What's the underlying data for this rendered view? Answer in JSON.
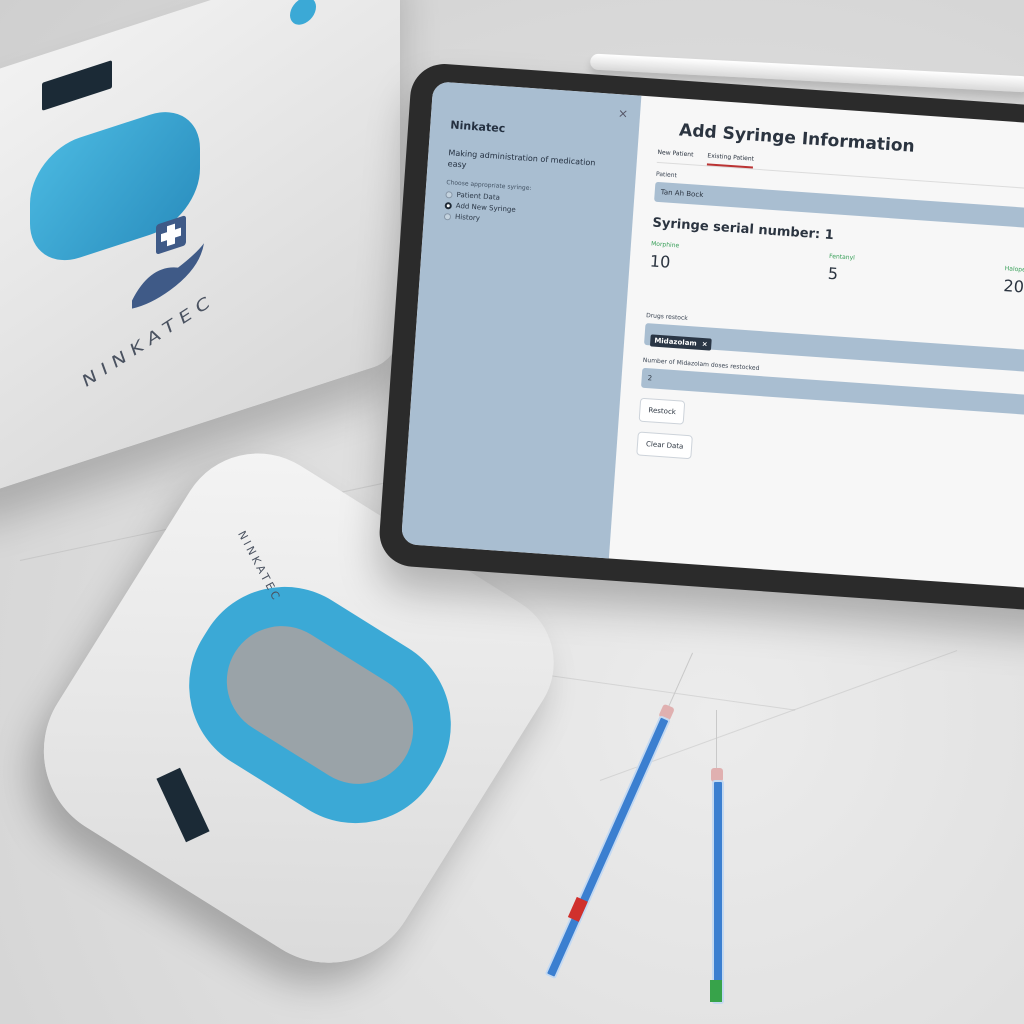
{
  "sidebar": {
    "close_symbol": "×",
    "brand": "Ninkatec",
    "tagline": "Making administration of medication easy",
    "radio_caption": "Choose appropriate syringe:",
    "options": [
      {
        "label": "Patient Data",
        "selected": false
      },
      {
        "label": "Add New Syringe",
        "selected": true
      },
      {
        "label": "History",
        "selected": false
      }
    ]
  },
  "main": {
    "title": "Add Syringe Information",
    "tabs": [
      {
        "label": "New Patient",
        "active": false
      },
      {
        "label": "Existing Patient",
        "active": true
      }
    ],
    "patient_label": "Patient",
    "patient_value": "Tan Ah Bock",
    "serial_heading": "Syringe serial number: 1",
    "drugs": [
      {
        "name": "Morphine",
        "count": "10"
      },
      {
        "name": "Fentanyl",
        "count": "5"
      },
      {
        "name": "Haloperidol",
        "count": "20"
      }
    ],
    "restock_label": "Drugs restock",
    "restock_chip": "Midazolam",
    "chip_remove": "×",
    "doses_label": "Number of Midazolam doses restocked",
    "doses_value": "2",
    "restock_button": "Restock",
    "clear_button": "Clear Data"
  },
  "device": {
    "dock_brand": "NINKATEC",
    "gun_brand": "NINKATEC"
  },
  "colors": {
    "sidebar_bg": "#a9bed1",
    "accent_blue": "#3ba9d6",
    "drug_label_green": "#3aa05a"
  }
}
